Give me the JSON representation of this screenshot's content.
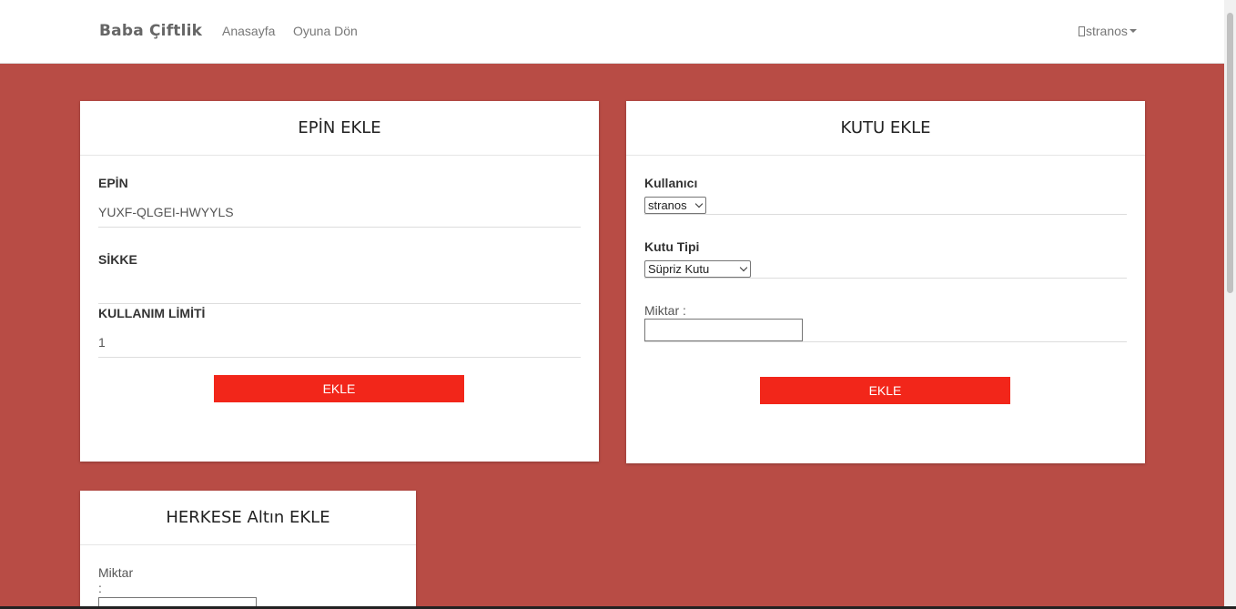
{
  "navbar": {
    "brand": "Baba Çiftlik",
    "links": [
      "Anasayfa",
      "Oyuna Dön"
    ],
    "user": "stranos"
  },
  "epin_card": {
    "title": "EPİN EKLE",
    "epin_label": "EPİN",
    "epin_value": "YUXF-QLGEI-HWYYLS",
    "sikke_label": "SİKKE",
    "sikke_value": "",
    "limit_label": "KULLANIM LİMİTİ",
    "limit_value": "1",
    "button": "EKLE"
  },
  "kutu_card": {
    "title": "KUTU EKLE",
    "user_label": "Kullanıcı",
    "user_selected": "stranos",
    "type_label": "Kutu Tipi",
    "type_selected": "Süpriz Kutu",
    "amount_label": "Miktar :",
    "amount_value": "",
    "button": "EKLE"
  },
  "herkese_card": {
    "title": "HERKESE Altın EKLE",
    "amount_label_line1": "Miktar",
    "amount_label_line2": ":",
    "amount_value": ""
  }
}
